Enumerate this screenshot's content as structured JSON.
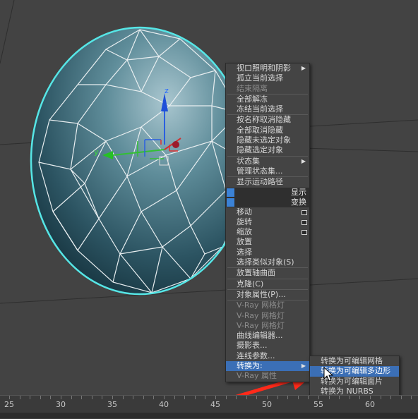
{
  "quad_menu": {
    "items": [
      {
        "label": "视口照明和阴影",
        "arrow": true
      },
      {
        "label": "孤立当前选择"
      },
      {
        "label": "结束隔离",
        "dim": true
      },
      {
        "sep": true
      },
      {
        "label": "全部解冻"
      },
      {
        "label": "冻结当前选择"
      },
      {
        "sep": true
      },
      {
        "label": "按名称取消隐藏"
      },
      {
        "label": "全部取消隐藏"
      },
      {
        "label": "隐藏未选定对象"
      },
      {
        "label": "隐藏选定对象"
      },
      {
        "sep": true
      },
      {
        "label": "状态集",
        "arrow": true
      },
      {
        "label": "管理状态集..."
      },
      {
        "sep": true
      },
      {
        "label": "显示运动路径"
      }
    ],
    "header_display": "显示",
    "header_transform": "变换",
    "transform_items": [
      {
        "label": "移动",
        "box": true
      },
      {
        "label": "旋转",
        "box": true
      },
      {
        "label": "缩放",
        "box": true
      },
      {
        "label": "放置"
      },
      {
        "label": "选择"
      },
      {
        "label": "选择类似对象(S)"
      },
      {
        "sep": true
      },
      {
        "label": "放置轴曲面"
      },
      {
        "sep": true
      },
      {
        "label": "克隆(C)"
      },
      {
        "sep": true
      },
      {
        "label": "对象属性(P)..."
      },
      {
        "sep": true
      },
      {
        "label": "V-Ray 网格灯",
        "dim": true
      },
      {
        "label": "V-Ray 网格灯",
        "dim": true
      },
      {
        "label": "V-Ray 网格灯",
        "dim": true
      },
      {
        "label": "曲线编辑器..."
      },
      {
        "label": "摄影表..."
      },
      {
        "label": "连线参数..."
      },
      {
        "label": "转换为:",
        "arrow": true,
        "highlight": true
      },
      {
        "label": "V-Ray 属性",
        "dim": true
      }
    ]
  },
  "convert_submenu": {
    "items": [
      {
        "label": "转换为可编辑网格"
      },
      {
        "label": "转换为可编辑多边形",
        "highlight": true
      },
      {
        "label": "转换为可编辑面片"
      },
      {
        "label": "转换为 NURBS"
      }
    ]
  },
  "gizmo": {
    "z_label": "z",
    "y_label": "y"
  },
  "timeline": {
    "ticks": [
      "25",
      "30",
      "35",
      "40",
      "45",
      "50",
      "55",
      "60"
    ]
  },
  "colors": {
    "highlight": "#3b6fb6",
    "selection_edge": "#56e6e6",
    "annotation_arrow": "#ff2a1a"
  }
}
